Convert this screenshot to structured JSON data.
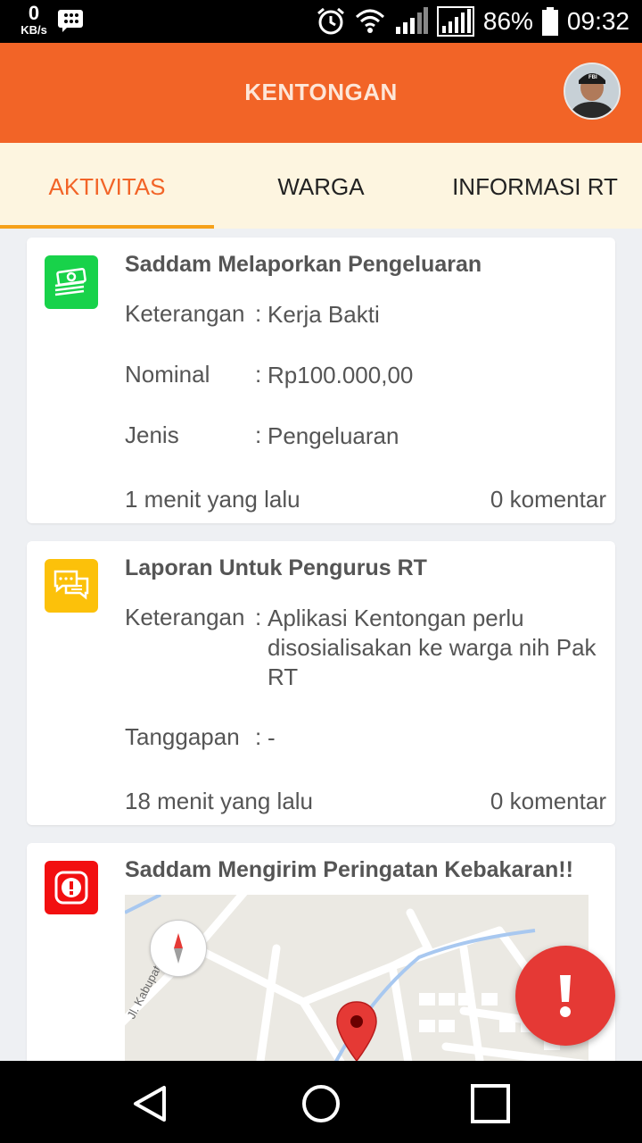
{
  "status_bar": {
    "net_speed_value": "0",
    "net_speed_unit": "KB/s",
    "battery_percent": "86%",
    "time": "09:32"
  },
  "app_bar": {
    "title": "KENTONGAN"
  },
  "tabs": [
    {
      "label": "AKTIVITAS",
      "active": true
    },
    {
      "label": "WARGA",
      "active": false
    },
    {
      "label": "INFORMASI RT",
      "active": false
    }
  ],
  "cards": [
    {
      "icon": "money-icon",
      "icon_color": "#18d24a",
      "title": "Saddam Melaporkan Pengeluaran",
      "fields": [
        {
          "label": "Keterangan",
          "value": "Kerja Bakti"
        },
        {
          "label": "Nominal",
          "value": "Rp100.000,00"
        },
        {
          "label": "Jenis",
          "value": "Pengeluaran"
        }
      ],
      "time": "1 menit yang lalu",
      "comments": "0 komentar"
    },
    {
      "icon": "chat-icon",
      "icon_color": "#fcc10a",
      "title": "Laporan Untuk Pengurus RT",
      "fields": [
        {
          "label": "Keterangan",
          "value": "Aplikasi Kentongan perlu disosialisakan ke warga nih Pak RT"
        },
        {
          "label": "Tanggapan",
          "value": "-"
        }
      ],
      "time": "18 menit yang lalu",
      "comments": "0 komentar"
    },
    {
      "icon": "alert-icon",
      "icon_color": "#f20f10",
      "title": "Saddam Mengirim Peringatan Kebakaran!!",
      "map": {
        "street_label": "Jl. Kabupaten"
      }
    }
  ],
  "colors": {
    "primary": "#f26427",
    "tab_bar_bg": "#fdf5e0",
    "tab_indicator": "#f6a11a",
    "fab": "#e53935"
  }
}
